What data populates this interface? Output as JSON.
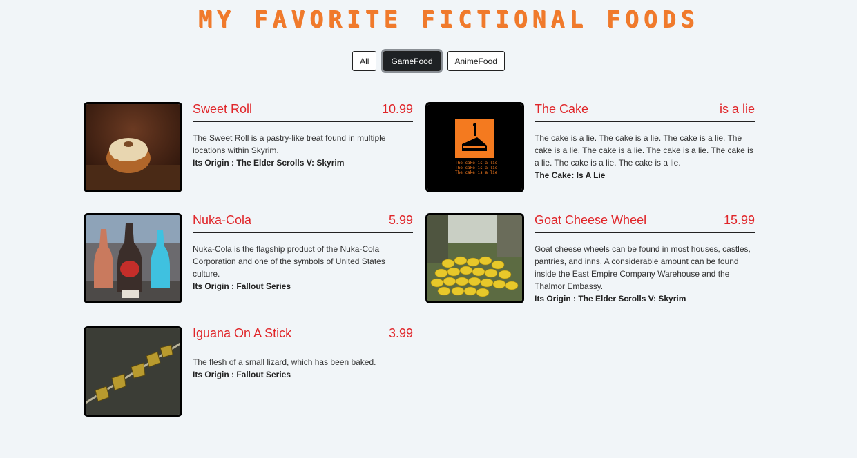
{
  "page": {
    "title": "MY FAVORITE FICTIONAL FOODS"
  },
  "filters": [
    {
      "label": "All",
      "active": false
    },
    {
      "label": "GameFood",
      "active": true
    },
    {
      "label": "AnimeFood",
      "active": false
    }
  ],
  "items": [
    {
      "name": "Sweet Roll",
      "price": "10.99",
      "description": "The Sweet Roll is a pastry-like treat found in multiple locations within Skyrim.",
      "origin": "Its Origin : The Elder Scrolls V: Skyrim",
      "image": "sweet-roll-image"
    },
    {
      "name": "The Cake",
      "price": "is a lie",
      "description": "The cake is a lie. The cake is a lie. The cake is a lie. The cake is a lie. The cake is a lie. The cake is a lie. The cake is a lie. The cake is a lie. The cake is a lie.",
      "origin": "The Cake: Is A Lie",
      "image": "cake-image",
      "image_text": "The cake is a lie"
    },
    {
      "name": "Nuka-Cola",
      "price": "5.99",
      "description": "Nuka-Cola is the flagship product of the Nuka-Cola Corporation and one of the symbols of United States culture.",
      "origin": "Its Origin : Fallout Series",
      "image": "nuka-cola-image"
    },
    {
      "name": "Goat Cheese Wheel",
      "price": "15.99",
      "description": "Goat cheese wheels can be found in most houses, castles, pantries, and inns. A considerable amount can be found inside the East Empire Company Warehouse and the Thalmor Embassy.",
      "origin": "Its Origin : The Elder Scrolls V: Skyrim",
      "image": "goat-cheese-image"
    },
    {
      "name": "Iguana On A Stick",
      "price": "3.99",
      "description": "The flesh of a small lizard, which has been baked.",
      "origin": "Its Origin : Fallout Series",
      "image": "iguana-image"
    }
  ],
  "colors": {
    "title": "#f07a2c",
    "item_heading": "#e0262a",
    "background": "#f1f5f8",
    "active_filter": "#1e2124"
  }
}
